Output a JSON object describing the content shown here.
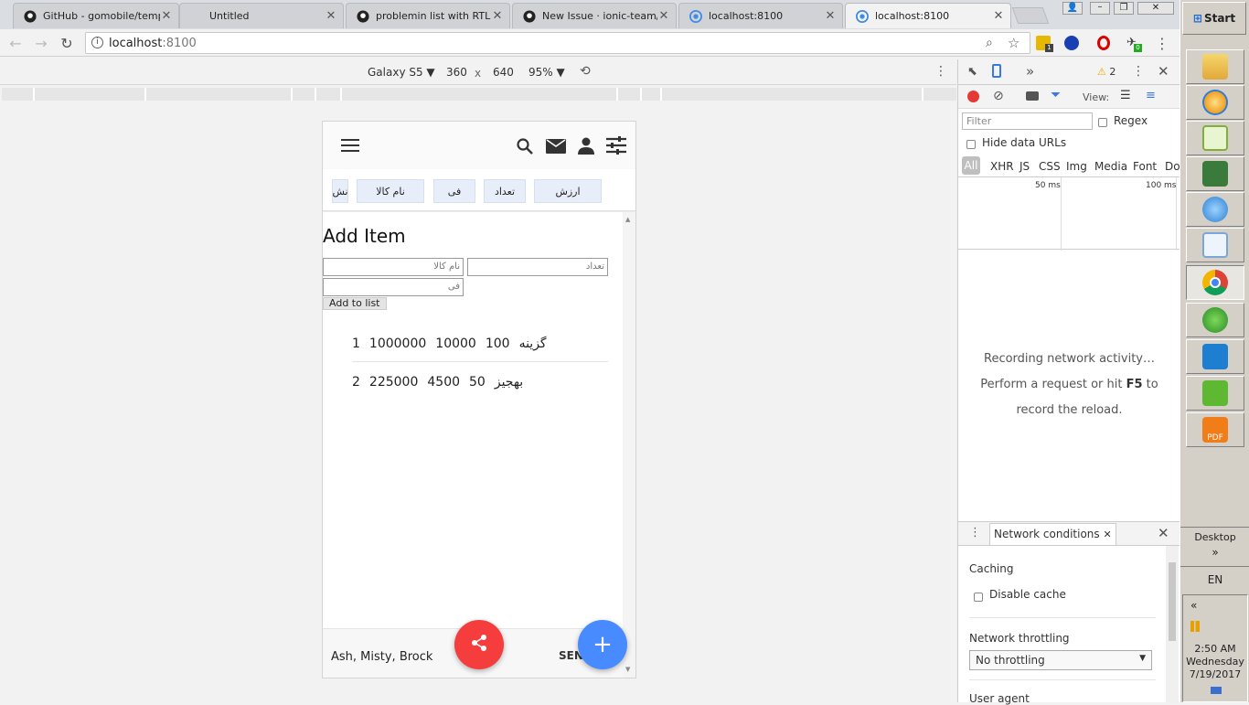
{
  "browser": {
    "tabs": [
      {
        "title": "GitHub - gomobile/templat",
        "icon": "github-icon",
        "active": false
      },
      {
        "title": "Untitled",
        "icon": "none",
        "active": false
      },
      {
        "title": "problemin list with RTL lan",
        "icon": "github-icon",
        "active": false
      },
      {
        "title": "New Issue · ionic-team/io",
        "icon": "github-icon",
        "active": false
      },
      {
        "title": "localhost:8100",
        "icon": "ionic-icon",
        "active": false
      },
      {
        "title": "localhost:8100",
        "icon": "ionic-icon",
        "active": true
      }
    ],
    "url_host": "localhost",
    "url_port": ":8100",
    "extension_badges": [
      "1",
      "0"
    ]
  },
  "device_toolbar": {
    "device": "Galaxy S5 ▼",
    "width": "360",
    "times": "x",
    "height": "640",
    "zoom": "95% ▼"
  },
  "app": {
    "chips": [
      "ارزش",
      "تعداد",
      "فی",
      "نام کالا",
      "نش"
    ],
    "heading": "Add Item",
    "inputs": {
      "name_placeholder": "نام کالا",
      "count_placeholder": "تعداد",
      "price_placeholder": "فی"
    },
    "add_button": "Add to list",
    "items": [
      {
        "index": "1",
        "value": "1000000",
        "price": "10000",
        "count": "100",
        "name": "گزینه"
      },
      {
        "index": "2",
        "value": "225000",
        "price": "4500",
        "count": "50",
        "name": "بهجیز"
      }
    ],
    "footer_text": "Ash, Misty, Brock",
    "footer_send": "SEN",
    "colors": {
      "share_fab": "#f53d3d",
      "add_fab": "#488aff"
    }
  },
  "devtools": {
    "warning_count": "2",
    "view_label": "View:",
    "filter_placeholder": "Filter",
    "regex_label": "Regex",
    "hide_data_urls": "Hide data URLs",
    "types": [
      "All",
      "XHR",
      "JS",
      "CSS",
      "Img",
      "Media",
      "Font",
      "Do"
    ],
    "timeline_ticks": [
      "50 ms",
      "100 ms"
    ],
    "recording_lines": [
      "Recording network activity…",
      "Perform a request or hit",
      "F5",
      "to",
      "record the reload."
    ],
    "drawer_tab": "Network conditions",
    "caching_label": "Caching",
    "disable_cache": "Disable cache",
    "throttling_label": "Network throttling",
    "throttling_value": "No throttling",
    "user_agent_label": "User agent"
  },
  "taskbar": {
    "start": "Start",
    "desktop": "Desktop",
    "chevron": "»",
    "lang": "EN",
    "tray_chevron": "«",
    "time": "2:50 AM",
    "day": "Wednesday",
    "date": "7/19/2017"
  }
}
